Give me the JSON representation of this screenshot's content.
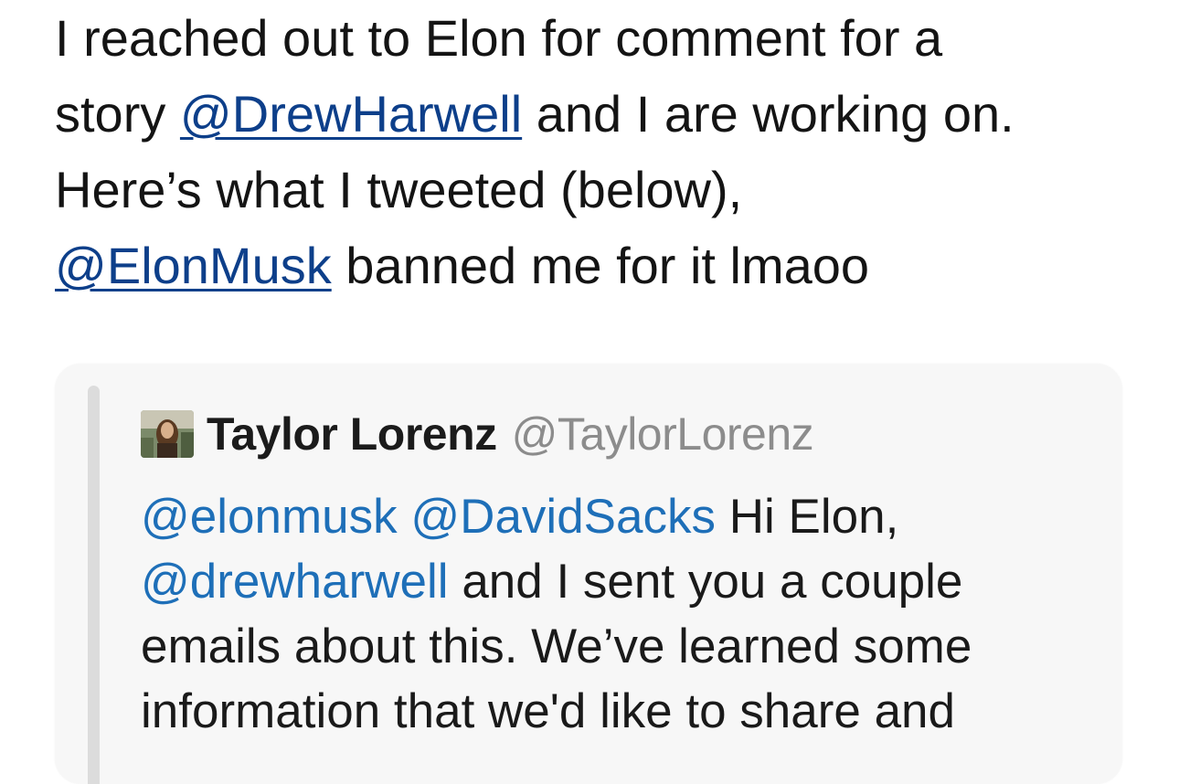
{
  "tweet": {
    "lines": [
      [
        {
          "text": "I reached out to Elon for comment for a"
        }
      ],
      [
        {
          "text": "story "
        },
        {
          "text": "@DrewHarwell",
          "mention": true
        },
        {
          "text": " and I are working on."
        }
      ],
      [
        {
          "text": "Here’s what I tweeted (below),"
        }
      ],
      [
        {
          "text": "@ElonMusk",
          "mention": true
        },
        {
          "text": " banned me for it lmaoo"
        }
      ]
    ]
  },
  "quote": {
    "author_name": "Taylor Lorenz",
    "author_handle": "@TaylorLorenz",
    "avatar": "profile-photo",
    "lines": [
      [
        {
          "text": "@elonmusk",
          "mention": true
        },
        {
          "text": " "
        },
        {
          "text": "@DavidSacks",
          "mention": true
        },
        {
          "text": " Hi Elon,"
        }
      ],
      [
        {
          "text": "@drewharwell",
          "mention": true
        },
        {
          "text": " and I sent you a couple"
        }
      ],
      [
        {
          "text": "emails about this. We’ve learned some"
        }
      ],
      [
        {
          "text": "information that we'd like to share and"
        }
      ]
    ]
  },
  "colors": {
    "link": "#0d3f8a",
    "quote_mention": "#1e6fb8",
    "handle": "#8c8c8c",
    "quote_background": "#f7f7f7",
    "quote_bar": "#dcdcdc"
  }
}
